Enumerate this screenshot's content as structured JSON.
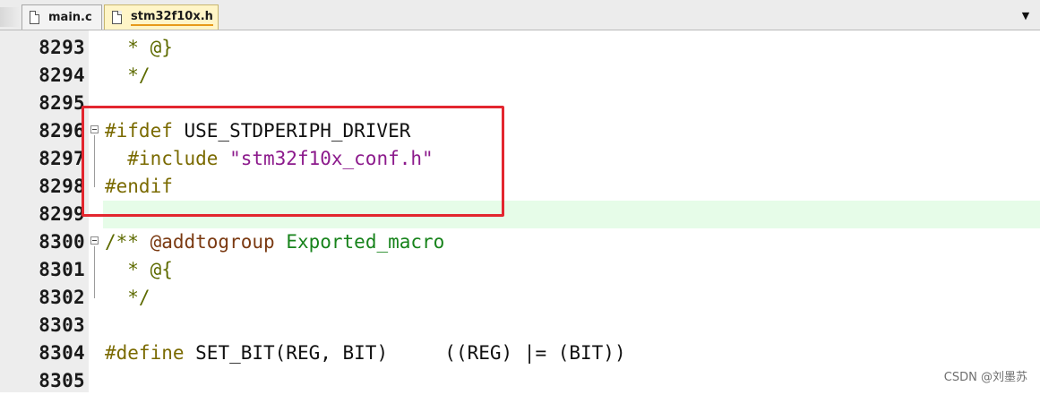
{
  "tabs": [
    {
      "label": "main.c",
      "active": false
    },
    {
      "label": "stm32f10x.h",
      "active": true
    }
  ],
  "editor": {
    "lines": [
      {
        "num": "8293",
        "tokens": [
          {
            "t": "  * @}",
            "c": "doc"
          }
        ]
      },
      {
        "num": "8294",
        "tokens": [
          {
            "t": "  */",
            "c": "doc"
          }
        ]
      },
      {
        "num": "8295",
        "tokens": []
      },
      {
        "num": "8296",
        "tokens": [
          {
            "t": "#ifdef",
            "c": "kw-pre"
          },
          {
            "t": " USE_STDPERIPH_DRIVER",
            "c": "plain"
          }
        ]
      },
      {
        "num": "8297",
        "tokens": [
          {
            "t": "  #include",
            "c": "kw-pre"
          },
          {
            "t": " ",
            "c": "plain"
          },
          {
            "t": "\"stm32f10x_conf.h\"",
            "c": "str"
          }
        ]
      },
      {
        "num": "8298",
        "tokens": [
          {
            "t": "#endif",
            "c": "kw-pre"
          }
        ]
      },
      {
        "num": "8299",
        "tokens": []
      },
      {
        "num": "8300",
        "tokens": [
          {
            "t": "/** ",
            "c": "doc"
          },
          {
            "t": "@addtogroup",
            "c": "doc-tag"
          },
          {
            "t": " ",
            "c": "doc"
          },
          {
            "t": "Exported_macro",
            "c": "doc-grp"
          }
        ]
      },
      {
        "num": "8301",
        "tokens": [
          {
            "t": "  * @{",
            "c": "doc"
          }
        ]
      },
      {
        "num": "8302",
        "tokens": [
          {
            "t": "  */",
            "c": "doc"
          }
        ]
      },
      {
        "num": "8303",
        "tokens": []
      },
      {
        "num": "8304",
        "tokens": [
          {
            "t": "#define",
            "c": "kw-pre"
          },
          {
            "t": " SET_BIT(REG, BIT)     ((REG) |= (BIT))",
            "c": "plain"
          }
        ]
      },
      {
        "num": "8305",
        "tokens": []
      }
    ],
    "highlighted_line": "8299",
    "fold_markers": [
      "8296",
      "8300"
    ]
  },
  "colors": {
    "annotation_box": "#e3262f",
    "current_line": "#e6fce8",
    "active_tab": "#fff5c7"
  },
  "watermark": "CSDN @刘墨苏"
}
